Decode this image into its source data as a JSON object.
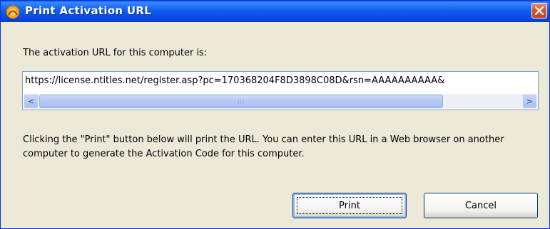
{
  "window": {
    "title": "Print Activation URL"
  },
  "dialog": {
    "prompt_label": "The activation URL for this computer is:",
    "url_value": "https://license.ntitles.net/register.asp?pc=170368204F8D3898C08D&rsn=AAAAAAAAAA&",
    "scrollbar": {
      "left_arrow": "<",
      "right_arrow": ">",
      "grip": "III",
      "thumb_fraction": 0.8
    },
    "info_text": "Clicking the \"Print\" button below will print the URL.  You can enter this URL in a Web browser on another computer to generate the Activation Code for this computer."
  },
  "buttons": {
    "print_label": "Print",
    "cancel_label": "Cancel"
  },
  "icons": {
    "app": "app-logo-icon",
    "close": "close-icon"
  },
  "colors": {
    "titlebar": "#0a5bf6",
    "close_button": "#d9572f",
    "dialog_bg": "#ece9d8"
  }
}
